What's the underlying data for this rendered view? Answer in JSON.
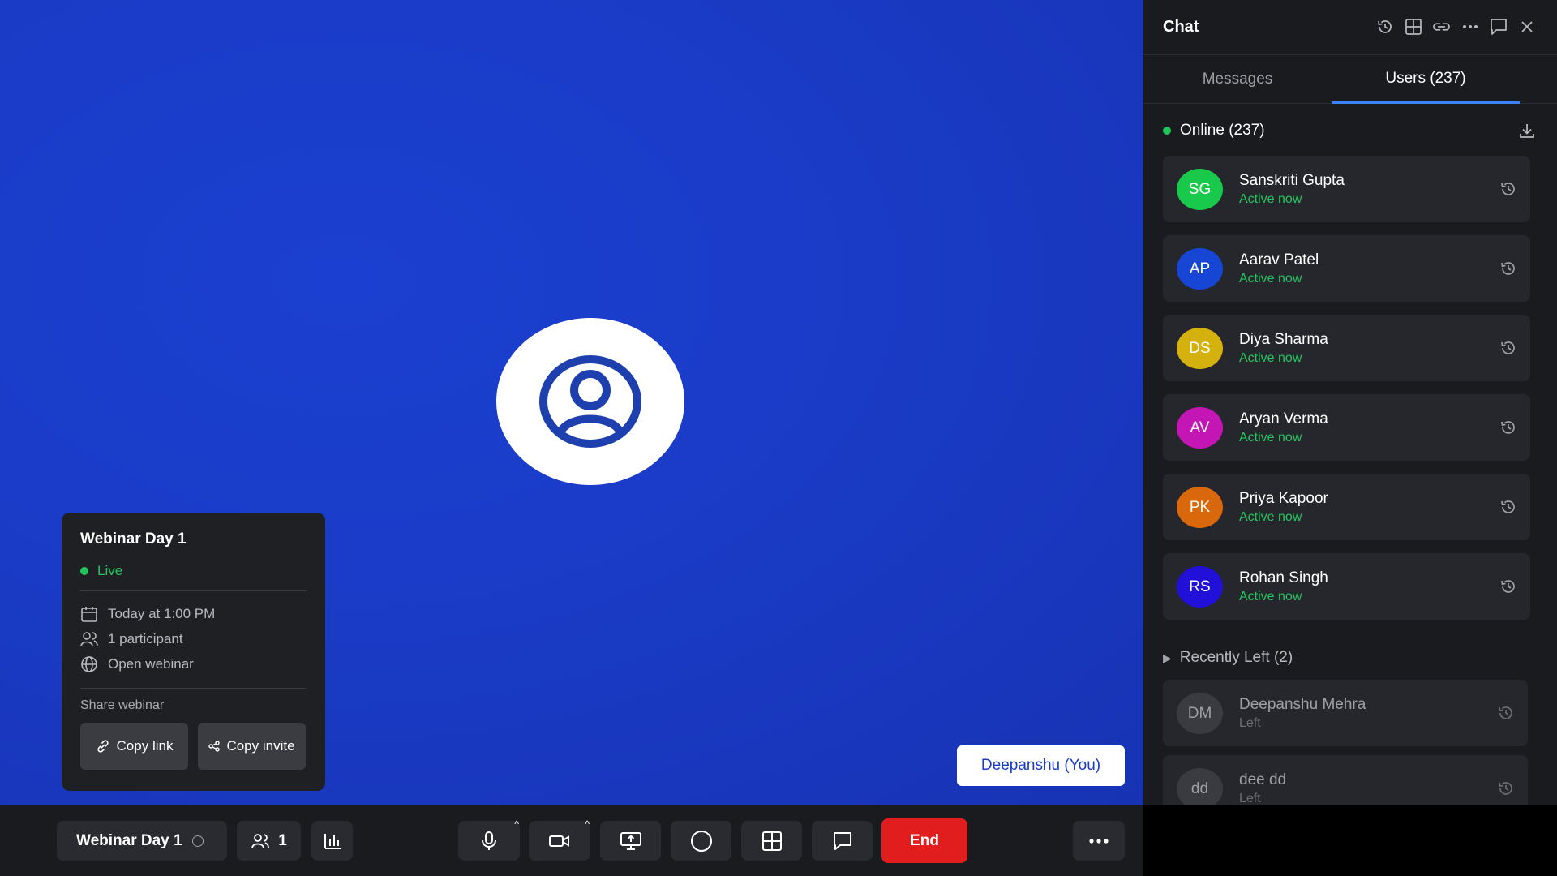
{
  "stage": {
    "you_label": "Deepanshu (You)"
  },
  "info_card": {
    "title": "Webinar Day 1",
    "status": "Live",
    "time": "Today at 1:00 PM",
    "participants": "1 participant",
    "type": "Open webinar",
    "share_label": "Share webinar",
    "copy_link": "Copy link",
    "copy_invite": "Copy invite"
  },
  "toolbar": {
    "webinar_name": "Webinar Day 1",
    "participant_count": "1",
    "end_label": "End"
  },
  "sidebar": {
    "title": "Chat",
    "tabs": {
      "messages": "Messages",
      "users": "Users (237)"
    },
    "online_label": "Online (237)",
    "users": [
      {
        "initials": "SG",
        "name": "Sanskriti Gupta",
        "status": "Active now",
        "color": "#19c94c"
      },
      {
        "initials": "AP",
        "name": "Aarav Patel",
        "status": "Active now",
        "color": "#1746d4"
      },
      {
        "initials": "DS",
        "name": "Diya Sharma",
        "status": "Active now",
        "color": "#d4b10d"
      },
      {
        "initials": "AV",
        "name": "Aryan Verma",
        "status": "Active now",
        "color": "#c416b4"
      },
      {
        "initials": "PK",
        "name": "Priya Kapoor",
        "status": "Active now",
        "color": "#d9670c"
      },
      {
        "initials": "RS",
        "name": " Rohan Singh",
        "status": "Active now",
        "color": "#2010d8"
      }
    ],
    "recently_left_label": "Recently Left (2)",
    "left_users": [
      {
        "initials": "DM",
        "name": "Deepanshu Mehra",
        "status": "Left"
      },
      {
        "initials": "dd",
        "name": "dee dd",
        "status": "Left"
      }
    ]
  },
  "colors": {
    "stage_blue": "#1a3cc8",
    "live_green": "#22c55e",
    "end_red": "#e11d1d",
    "tab_accent": "#3b82f6"
  }
}
